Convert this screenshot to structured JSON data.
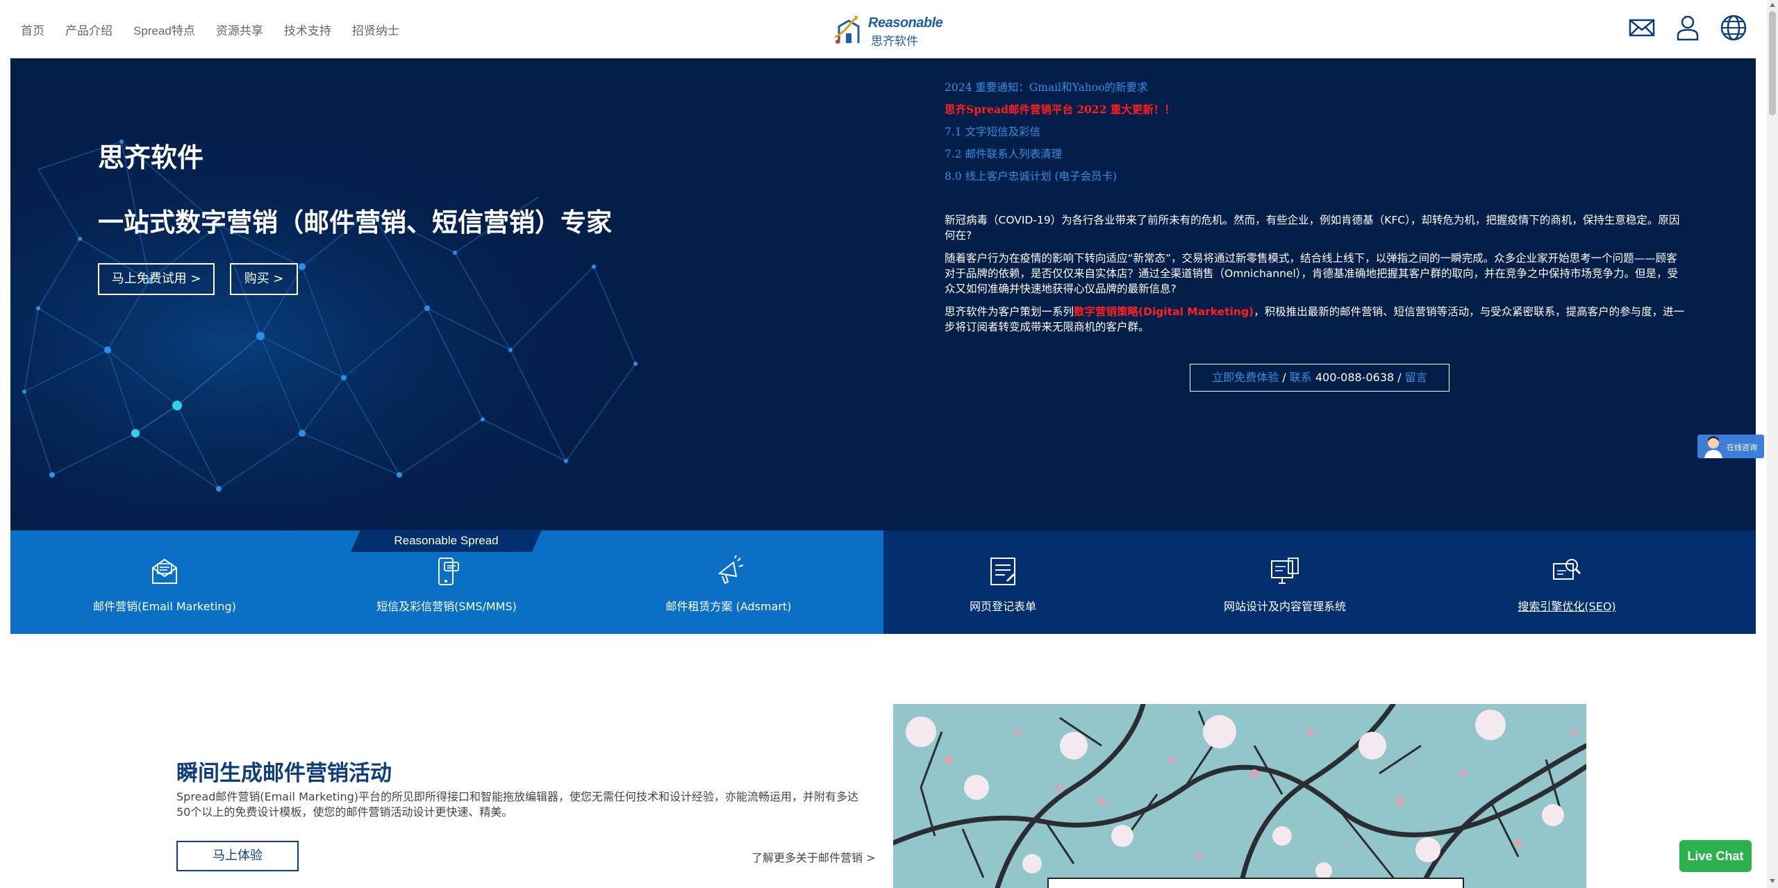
{
  "nav": {
    "links": [
      "首页",
      "产品介绍",
      "Spread特点",
      "资源共享",
      "技术支持",
      "招贤纳士"
    ],
    "icons": [
      "mail-icon",
      "user-icon",
      "globe-icon"
    ]
  },
  "logo": {
    "en": "Reasonable",
    "cn": "思齐软件"
  },
  "hero": {
    "title": "思齐软件",
    "subtitle": "一站式数字营销（邮件营销、短信营销）专家",
    "btn_trial": "马上免费试用 >",
    "btn_buy": "购买 >"
  },
  "news": [
    {
      "text": "2024 重要通知：Gmail和Yahoo的新要求",
      "highlight": false
    },
    {
      "text": "思齐Spread邮件营销平台 2022 重大更新！！",
      "highlight": true
    },
    {
      "text": "7.1 文字短信及彩信",
      "highlight": false
    },
    {
      "text": "7.2 邮件联系人列表清理",
      "highlight": false
    },
    {
      "text": "8.0 线上客户忠诚计划 (电子会员卡)",
      "highlight": false
    }
  ],
  "article": {
    "p1": "新冠病毒（COVID-19）为各行各业带来了前所未有的危机。然而，有些企业，例如肯德基（KFC），却转危为机，把握疫情下的商机，保持生意稳定。原因何在?",
    "p2": "随着客户行为在疫情的影响下转向适应“新常态”，交易将通过新零售模式，结合线上线下，以弹指之间的一瞬完成。众多企业家开始思考一个问题——顾客对于品牌的依赖，是否仅仅来自实体店？通过全渠道销售（Omnichannel），肯德基准确地把握其客户群的取向，并在竞争之中保持市场竞争力。但是，受众又如何准确并快速地获得心仪品牌的最新信息?",
    "p3_before": "思齐软件为客户策划一系列",
    "p3_highlight": "数字营销策略(Digital Marketing)",
    "p3_after": "，积极推出最新的邮件营销、短信营销等活动，与受众紧密联系，提高客户的参与度，进一步将订阅者转变成带来无限商机的客户群。"
  },
  "contact": {
    "trial": "立即免费体验",
    "sep1": " / ",
    "contact_label": "联系",
    "phone": " 400-088-0638",
    "sep2": " / ",
    "message": "留言"
  },
  "features": {
    "tab_label": "Reasonable Spread",
    "items": [
      {
        "label": "邮件营销(Email Marketing)",
        "icon": "email-marketing-icon"
      },
      {
        "label": "短信及彩信营销(SMS/MMS)",
        "icon": "sms-mms-icon"
      },
      {
        "label": "邮件租赁方案 (Adsmart)",
        "icon": "adsmart-icon"
      },
      {
        "label": "网页登记表单",
        "icon": "web-form-icon"
      },
      {
        "label": "网站设计及内容管理系统",
        "icon": "website-cms-icon"
      },
      {
        "label": "搜索引擎优化(SEO)",
        "icon": "seo-icon"
      }
    ]
  },
  "section": {
    "title": "瞬间生成邮件营销活动",
    "desc": "Spread邮件营销(Email Marketing)平台的所见即所得接口和智能拖放编辑器，使您无需任何技术和设计经验，亦能流畅运用，并附有多达50个以上的免费设计模板，使您的邮件营销活动设计更快速、精美。",
    "btn": "马上体验",
    "more": "了解更多关于邮件营销 >"
  },
  "widgets": {
    "consult": "在线咨询",
    "live_chat": "Live Chat"
  },
  "colors": {
    "hero_bg": "#041e4a",
    "feature_left": "#0a70c6",
    "feature_right": "#032f6e",
    "link_blue": "#2f8fe0",
    "highlight_red": "#ff1f1f",
    "title_navy": "#0e3d7c",
    "live_chat_green": "#2bb24c"
  }
}
